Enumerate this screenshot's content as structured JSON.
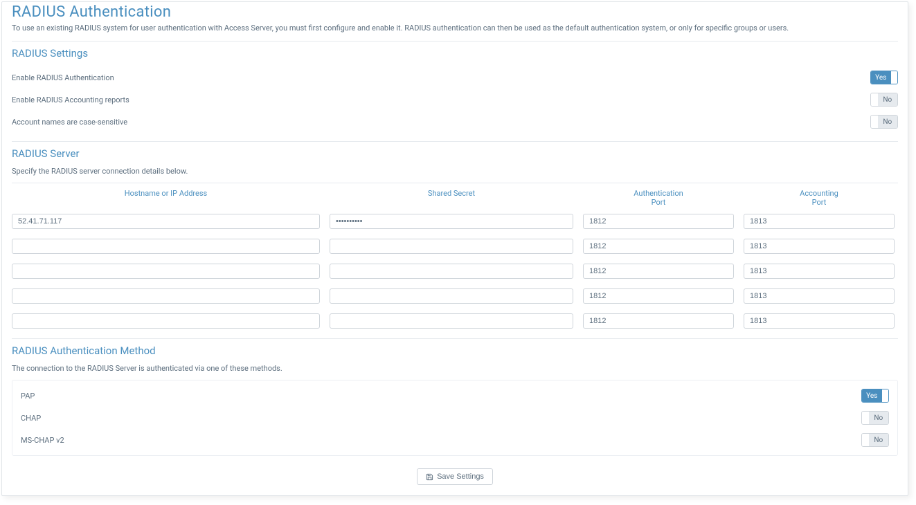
{
  "page": {
    "title": "RADIUS Authentication",
    "description": "To use an existing RADIUS system for user authentication with Access Server, you must first configure and enable it. RADIUS authentication can then be used as the default authentication system, or only for specific groups or users."
  },
  "settings": {
    "title": "RADIUS Settings",
    "items": [
      {
        "label": "Enable RADIUS Authentication",
        "value": "Yes",
        "on": true
      },
      {
        "label": "Enable RADIUS Accounting reports",
        "value": "No",
        "on": false
      },
      {
        "label": "Account names are case-sensitive",
        "value": "No",
        "on": false
      }
    ]
  },
  "server": {
    "title": "RADIUS Server",
    "description": "Specify the RADIUS server connection details below.",
    "headers": {
      "host": "Hostname or IP Address",
      "secret": "Shared Secret",
      "auth_port_l1": "Authentication",
      "auth_port_l2": "Port",
      "acct_port_l1": "Accounting",
      "acct_port_l2": "Port"
    },
    "rows": [
      {
        "host": "52.41.71.117",
        "secret": "••••••••••",
        "auth_port": "1812",
        "acct_port": "1813"
      },
      {
        "host": "",
        "secret": "",
        "auth_port": "1812",
        "acct_port": "1813"
      },
      {
        "host": "",
        "secret": "",
        "auth_port": "1812",
        "acct_port": "1813"
      },
      {
        "host": "",
        "secret": "",
        "auth_port": "1812",
        "acct_port": "1813"
      },
      {
        "host": "",
        "secret": "",
        "auth_port": "1812",
        "acct_port": "1813"
      }
    ]
  },
  "method": {
    "title": "RADIUS Authentication Method",
    "description": "The connection to the RADIUS Server is authenticated via one of these methods.",
    "items": [
      {
        "label": "PAP",
        "value": "Yes",
        "on": true
      },
      {
        "label": "CHAP",
        "value": "No",
        "on": false
      },
      {
        "label": "MS-CHAP v2",
        "value": "No",
        "on": false
      }
    ]
  },
  "buttons": {
    "save": "Save Settings"
  }
}
